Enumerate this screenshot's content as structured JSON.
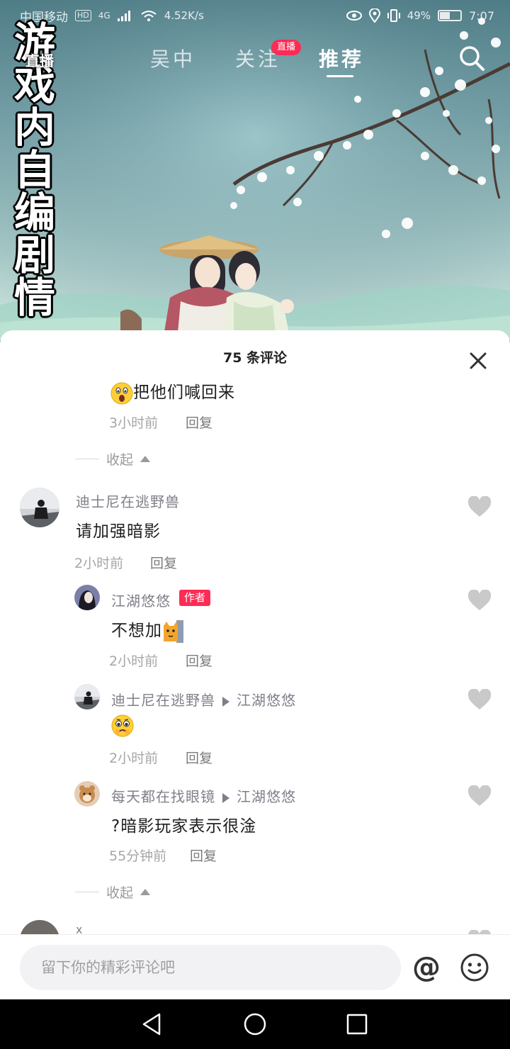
{
  "status_bar": {
    "carrier": "中国移动",
    "network": "4G",
    "hd_label": "HD",
    "speed": "4.52K/s",
    "battery": "49%",
    "battery_level": 0.49,
    "time": "7:07"
  },
  "video": {
    "vertical_title": [
      "游",
      "戏",
      "内",
      "自",
      "编",
      "剧",
      "情"
    ],
    "live_label": "直播",
    "tabs": [
      {
        "label": "吴中",
        "active": false
      },
      {
        "label": "关注",
        "active": false,
        "badge": "直播"
      },
      {
        "label": "推荐",
        "active": true
      }
    ]
  },
  "comments_panel": {
    "title": "75 条评论",
    "prev_reply": {
      "text": "把他们喊回来",
      "time": "3小时前",
      "reply_label": "回复",
      "emoji": "surprised-emoji"
    },
    "collapse_label": "收起",
    "main_comment": {
      "user": "迪士尼在逃野兽",
      "text": "请加强暗影",
      "time": "2小时前",
      "reply_label": "回复"
    },
    "replies": [
      {
        "user": "江湖悠悠",
        "tag": "作者",
        "text": "不想加",
        "time": "2小时前",
        "reply_label": "回复",
        "emoji": "cat-peek-emoji"
      },
      {
        "user": "迪士尼在逃野兽",
        "reply_to": "江湖悠悠",
        "text": "",
        "time": "2小时前",
        "reply_label": "回复",
        "emoji": "pleading-emoji"
      },
      {
        "user": "每天都在找眼镜",
        "reply_to": "江湖悠悠",
        "text": "?暗影玩家表示很淦",
        "time": "55分钟前",
        "reply_label": "回复"
      }
    ],
    "collapse_label_2": "收起",
    "partial_next_user": "x"
  },
  "input_bar": {
    "placeholder": "留下你的精彩评论吧",
    "at_symbol": "@"
  },
  "colors": {
    "accent": "#fe2c55",
    "like_gray": "#c9c9c9"
  }
}
